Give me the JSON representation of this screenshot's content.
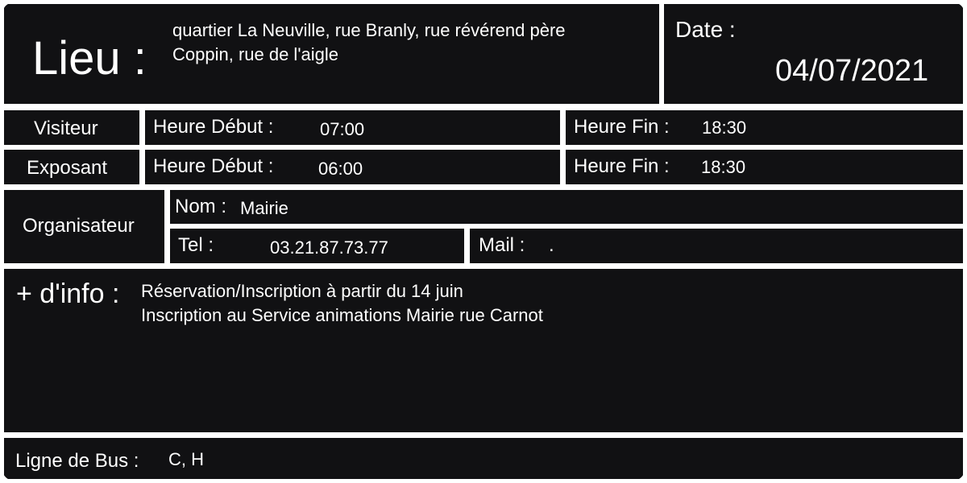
{
  "lieu": {
    "label": "Lieu :",
    "address_line1": "quartier La Neuville, rue Branly, rue révérend père",
    "address_line2": "Coppin, rue de l'aigle"
  },
  "date": {
    "label": "Date :",
    "value": "04/07/2021"
  },
  "visiteur": {
    "label": "Visiteur",
    "debut_label": "Heure Début :",
    "debut_value": "07:00",
    "fin_label": "Heure Fin :",
    "fin_value": "18:30"
  },
  "exposant": {
    "label": "Exposant",
    "debut_label": "Heure Début :",
    "debut_value": "06:00",
    "fin_label": "Heure Fin :",
    "fin_value": "18:30"
  },
  "organisateur": {
    "label": "Organisateur",
    "nom_label": "Nom :",
    "nom_value": "Mairie",
    "tel_label": "Tel :",
    "tel_value": "03.21.87.73.77",
    "mail_label": "Mail :",
    "mail_value": "."
  },
  "info": {
    "label": "+ d'info :",
    "line1": "Réservation/Inscription à partir du 14 juin",
    "line2": "Inscription au Service animations Mairie rue Carnot"
  },
  "bus": {
    "label": "Ligne de Bus :",
    "value": "C, H"
  }
}
